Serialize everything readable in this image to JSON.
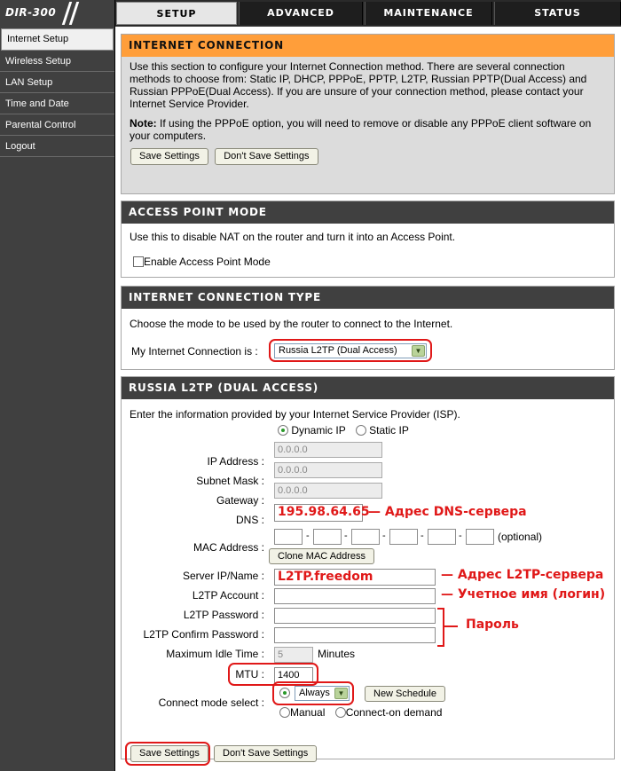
{
  "logo": "DIR-300",
  "tabs": [
    "SETUP",
    "ADVANCED",
    "MAINTENANCE",
    "STATUS"
  ],
  "sidebar": {
    "items": [
      "Internet Setup",
      "Wireless Setup",
      "LAN Setup",
      "Time and Date",
      "Parental Control",
      "Logout"
    ]
  },
  "internet_connection": {
    "title": "INTERNET CONNECTION",
    "description": "Use this section to configure your Internet Connection method. There are several connection methods to choose from: Static IP, DHCP, PPPoE, PPTP, L2TP, Russian PPTP(Dual Access) and Russian PPPoE(Dual Access). If you are unsure of your connection method, please contact your Internet Service Provider.",
    "note_label": "Note:",
    "note_text": " If using the PPPoE option, you will need to remove or disable any PPPoE client software on your computers.",
    "save_label": "Save Settings",
    "dont_save_label": "Don't Save Settings"
  },
  "access_point": {
    "title": "ACCESS POINT MODE",
    "description": "Use this to disable NAT on the router and turn it into an Access Point.",
    "checkbox_label": "Enable Access Point Mode"
  },
  "connection_type": {
    "title": "INTERNET CONNECTION TYPE",
    "description": "Choose the mode to be used by the router to connect to the Internet.",
    "label": "My Internet Connection is :",
    "selected": "Russia L2TP (Dual Access)"
  },
  "l2tp": {
    "title": "RUSSIA L2TP (DUAL ACCESS)",
    "description": "Enter the information provided by your Internet Service Provider (ISP).",
    "dynamic_ip": "Dynamic IP",
    "static_ip": "Static IP",
    "ip_label": "IP Address :",
    "ip_value": "0.0.0.0",
    "mask_label": "Subnet Mask :",
    "mask_value": "0.0.0.0",
    "gateway_label": "Gateway :",
    "gateway_value": "0.0.0.0",
    "dns_label": "DNS :",
    "dns_value": "195.98.64.65",
    "mac_label": "MAC Address :",
    "mac_sep": "-",
    "mac_optional": "(optional)",
    "clone_label": "Clone MAC Address",
    "server_label": "Server IP/Name :",
    "server_value": "L2TP.freedom",
    "account_label": "L2TP Account :",
    "password_label": "L2TP Password :",
    "confirm_label": "L2TP Confirm Password :",
    "idle_label": "Maximum Idle Time :",
    "idle_value": "5",
    "idle_unit": "Minutes",
    "mtu_label": "MTU :",
    "mtu_value": "1400",
    "connect_label": "Connect mode select :",
    "connect_selected": "Always",
    "new_schedule_label": "New Schedule",
    "manual_label": "Manual",
    "on_demand_label": "Connect-on demand"
  },
  "annotations": {
    "dns": "— Адрес DNS-сервера",
    "server": "— Адрес L2TP-сервера",
    "account": "— Учетное имя (логин)",
    "password": "Пароль"
  },
  "bottom": {
    "save_label": "Save Settings",
    "dont_save_label": "Don't Save Settings"
  },
  "colors": {
    "accent_orange": "#ff9e3a",
    "header_dark": "#404040",
    "annotation_red": "#e01818"
  }
}
